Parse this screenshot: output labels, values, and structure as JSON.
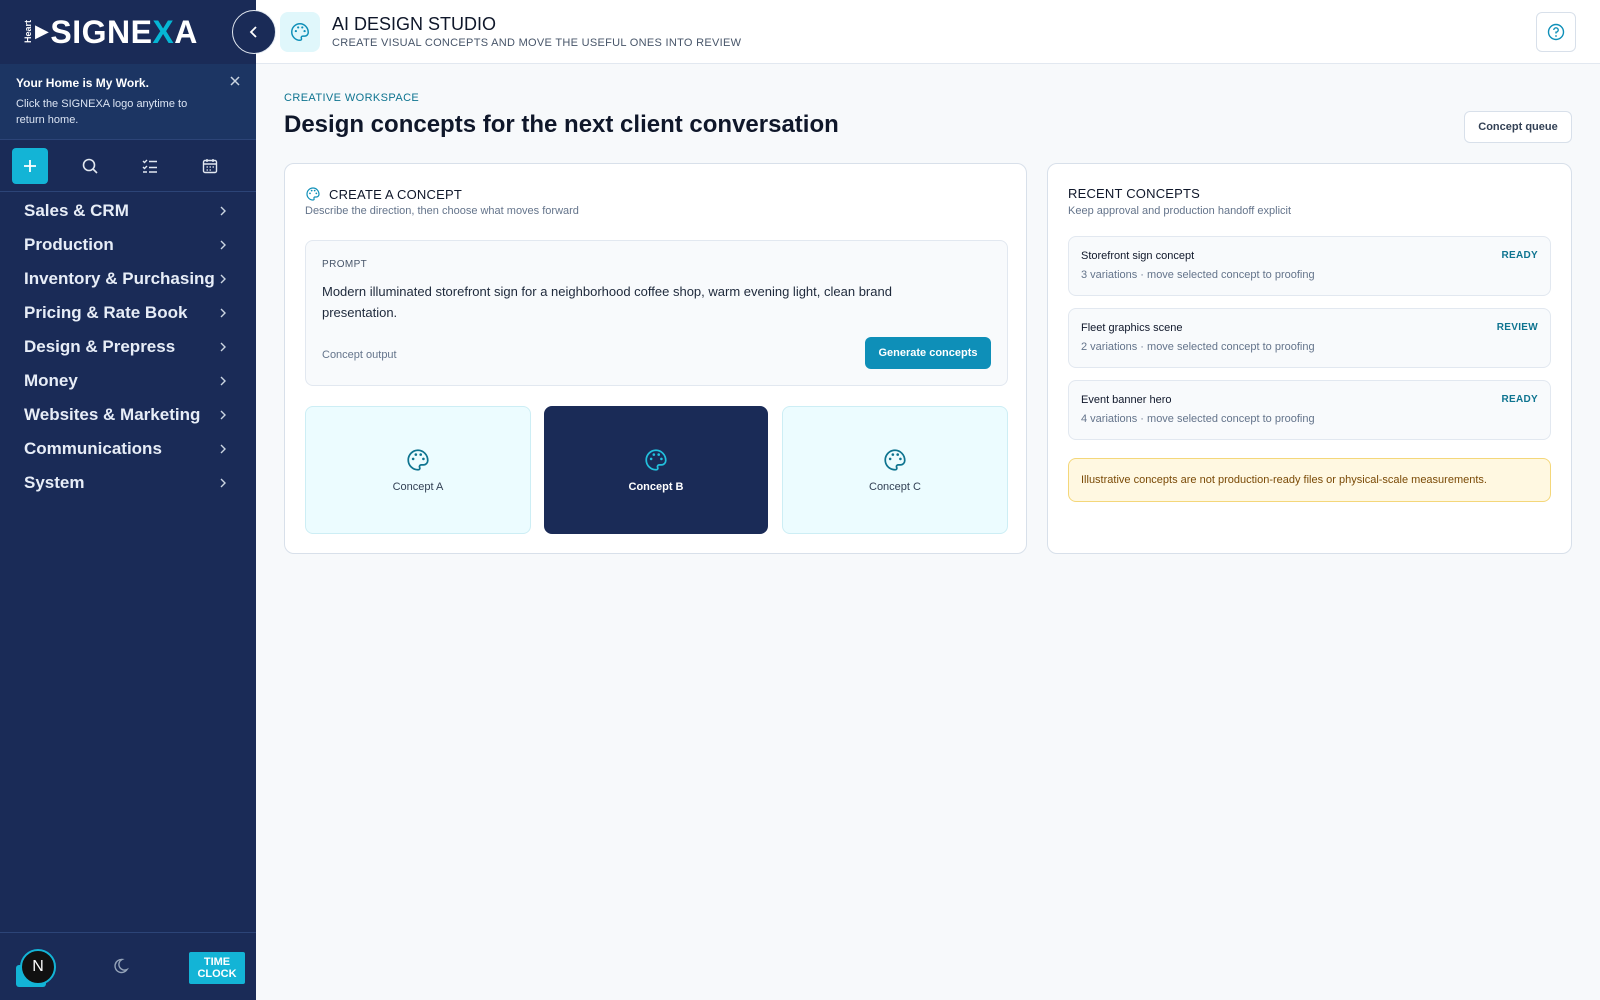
{
  "brand": {
    "mini": "Heart",
    "name_a": "SIGNE",
    "name_x": "X",
    "name_b": "A"
  },
  "sidebar": {
    "notice": {
      "title": "Your Home is My Work.",
      "body": "Click the SIGNEXA logo anytime to return home."
    },
    "nav": [
      {
        "label": "Sales & CRM"
      },
      {
        "label": "Production"
      },
      {
        "label": "Inventory & Purchasing"
      },
      {
        "label": "Pricing & Rate Book"
      },
      {
        "label": "Design & Prepress"
      },
      {
        "label": "Money"
      },
      {
        "label": "Websites & Marketing"
      },
      {
        "label": "Communications"
      },
      {
        "label": "System"
      }
    ],
    "avatar_letter": "N",
    "time_clock": "TIME CLOCK"
  },
  "header": {
    "title": "AI DESIGN STUDIO",
    "subtitle": "CREATE VISUAL CONCEPTS AND MOVE THE USEFUL ONES INTO REVIEW"
  },
  "main": {
    "eyebrow": "CREATIVE WORKSPACE",
    "title": "Design concepts for the next client conversation",
    "queue_button": "Concept queue"
  },
  "create": {
    "title": "CREATE A CONCEPT",
    "desc": "Describe the direction, then choose what moves forward",
    "prompt_label": "PROMPT",
    "prompt_text": "Modern illuminated storefront sign for a neighborhood coffee shop, warm evening light, clean brand presentation.",
    "output_label": "Concept output",
    "generate_button": "Generate concepts",
    "concepts": [
      {
        "label": "Concept A",
        "selected": false
      },
      {
        "label": "Concept B",
        "selected": true
      },
      {
        "label": "Concept C",
        "selected": false
      }
    ]
  },
  "recent": {
    "title": "RECENT CONCEPTS",
    "desc": "Keep approval and production handoff explicit",
    "items": [
      {
        "name": "Storefront sign concept",
        "meta": "3 variations · move selected concept to proofing",
        "status": "READY"
      },
      {
        "name": "Fleet graphics scene",
        "meta": "2 variations · move selected concept to proofing",
        "status": "REVIEW"
      },
      {
        "name": "Event banner hero",
        "meta": "4 variations · move selected concept to proofing",
        "status": "READY"
      }
    ],
    "warning": "Illustrative concepts are not production-ready files or physical-scale measurements."
  },
  "colors": {
    "sidebar": "#1a2b57",
    "accent": "#13b4d6",
    "primary_button": "#0e8fb8",
    "status": "#0e7490"
  }
}
